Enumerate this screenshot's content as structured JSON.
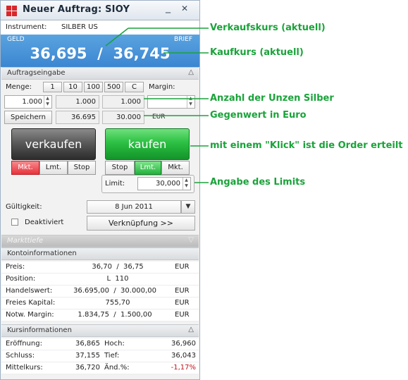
{
  "window": {
    "title": "Neuer Auftrag: SIOY",
    "minimize_glyph": "_",
    "close_glyph": "✕"
  },
  "instrument": {
    "label": "Instrument:",
    "value": "SILBER US"
  },
  "quote": {
    "bid_label": "GELD",
    "ask_label": "BRIEF",
    "price": "36,695  /  36,745"
  },
  "order_entry": {
    "header": "Auftragseingabe",
    "qty_label": "Menge:",
    "qty_buttons": [
      "1",
      "10",
      "100",
      "500",
      "C"
    ],
    "margin_label": "Margin:",
    "qty_value": "1.000",
    "qty_display": "1.000",
    "qty_display2": "1.000",
    "save_label": "Speichern",
    "price_value": "36.695",
    "value_eur": "30.000",
    "currency": "EUR",
    "sell_label": "verkaufen",
    "buy_label": "kaufen",
    "sell_types": [
      "Mkt.",
      "Lmt.",
      "Stop"
    ],
    "buy_types": [
      "Stop",
      "Lmt.",
      "Mkt."
    ],
    "limit_label": "Limit:",
    "limit_value": "30,000",
    "validity_label": "Gültigkeit:",
    "validity_value": "8 Jun 2011",
    "deactivated_label": "Deaktiviert",
    "link_label": "Verknüpfung >>"
  },
  "market_depth": {
    "header": "Markttiefe"
  },
  "account": {
    "header": "Kontoinformationen",
    "rows": [
      {
        "label": "Preis:",
        "value": "36,70  /  36,75",
        "unit": "EUR"
      },
      {
        "label": "Position:",
        "value": "L  110",
        "unit": ""
      },
      {
        "label": "Handelswert:",
        "value": "36.695,00  /  30.000,00",
        "unit": "EUR"
      },
      {
        "label": "Freies Kapital:",
        "value": "755,70",
        "unit": "EUR"
      },
      {
        "label": "Notw. Margin:",
        "value": "1.834,75  /  1.500,00",
        "unit": "EUR"
      }
    ]
  },
  "price_info": {
    "header": "Kursinformationen",
    "rows": [
      {
        "l1": "Eröffnung:",
        "v1": "36,865",
        "l2": "Hoch:",
        "v2": "36,960"
      },
      {
        "l1": "Schluss:",
        "v1": "37,155",
        "l2": "Tief:",
        "v2": "36,043"
      },
      {
        "l1": "Mittelkurs:",
        "v1": "36,720",
        "l2": "Änd.%:",
        "v2": "-1,17%"
      }
    ]
  },
  "annotations": {
    "sell_price": "Verkaufskurs (aktuell)",
    "buy_price": "Kaufkurs (aktuell)",
    "ounces": "Anzahl der Unzen Silber",
    "value": "Gegenwert in Euro",
    "one_click": "mit einem \"Klick\" ist die Order erteilt",
    "limit": "Angabe des Limits"
  },
  "colors": {
    "accent_green": "#1aa33a",
    "quote_blue": "#3b86d1",
    "sell_gray": "#4a4a4a",
    "buy_green": "#22b33d",
    "active_red": "#e8323a",
    "negative_red": "#c0141b"
  }
}
